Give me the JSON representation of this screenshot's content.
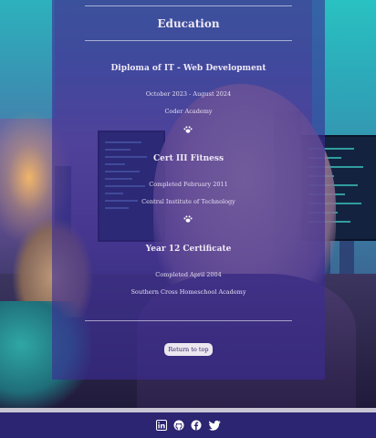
{
  "education": {
    "heading": "Education",
    "items": [
      {
        "title": "Diploma of IT - Web Development",
        "dates": "October 2023 - August 2024",
        "institution": "Coder Academy"
      },
      {
        "title": "Cert III Fitness",
        "dates": "Completed February 2011",
        "institution": "Central Institute of Technology"
      },
      {
        "title": "Year 12 Certificate",
        "dates": "Completed April 2004",
        "institution": "Southern Cross Homeschool Academy"
      }
    ],
    "separator_icon": "paw-icon"
  },
  "back_to_top": "Return to top",
  "footer": {
    "icons": [
      "linkedin-icon",
      "github-icon",
      "facebook-icon",
      "twitter-icon"
    ]
  },
  "colors": {
    "card": "#3c2c96",
    "footer": "#2c2572",
    "text": "#efe9f6",
    "button_bg": "#ece6ef",
    "button_text": "#2e2466"
  }
}
